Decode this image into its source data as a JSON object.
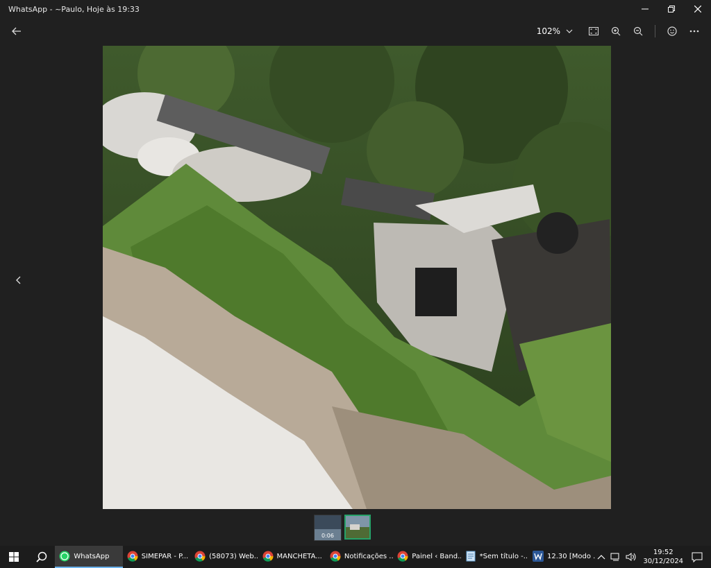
{
  "window": {
    "title": "WhatsApp - ~Paulo, Hoje às 19:33",
    "minimize_icon": "minimize-icon",
    "restore_icon": "restore-icon",
    "close_icon": "close-icon"
  },
  "toolbar": {
    "back_icon": "back-arrow-icon",
    "zoom_level": "102%",
    "icons": [
      "chevron-down-icon",
      "fullscreen-icon",
      "zoom-in-icon",
      "zoom-out-icon",
      "emoji-icon",
      "more-options-icon"
    ]
  },
  "viewer": {
    "prev_icon": "chevron-left-icon"
  },
  "filmstrip": {
    "items": [
      {
        "duration": "0:06"
      },
      {
        "selected": true
      }
    ],
    "accent": "#26a269"
  },
  "taskbar": {
    "tasks": [
      {
        "label": "WhatsApp",
        "icon": "whatsapp-icon",
        "active": true
      },
      {
        "label": "SIMEPAR - P...",
        "icon": "chrome-icon"
      },
      {
        "label": "(58073) Web...",
        "icon": "chrome-icon"
      },
      {
        "label": "MANCHETA...",
        "icon": "chrome-icon"
      },
      {
        "label": "Notificações ...",
        "icon": "chrome-icon"
      },
      {
        "label": "Painel ‹ Band...",
        "icon": "chrome-icon"
      },
      {
        "label": "*Sem título -...",
        "icon": "notepad-icon"
      },
      {
        "label": "12.30 [Modo ...",
        "icon": "word-icon"
      }
    ],
    "clock": {
      "time": "19:52",
      "date": "30/12/2024"
    }
  }
}
